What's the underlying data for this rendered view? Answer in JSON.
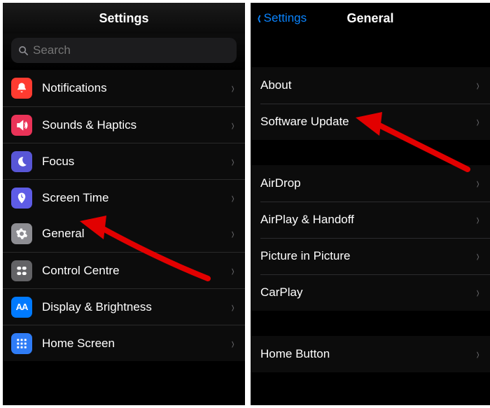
{
  "left": {
    "title": "Settings",
    "search_placeholder": "Search",
    "group1": [
      {
        "label": "Notifications"
      },
      {
        "label": "Sounds & Haptics"
      },
      {
        "label": "Focus"
      },
      {
        "label": "Screen Time"
      }
    ],
    "group2": [
      {
        "label": "General"
      },
      {
        "label": "Control Centre"
      },
      {
        "label": "Display & Brightness"
      },
      {
        "label": "Home Screen"
      }
    ]
  },
  "right": {
    "back_label": "Settings",
    "title": "General",
    "group1": [
      {
        "label": "About"
      },
      {
        "label": "Software Update"
      }
    ],
    "group2": [
      {
        "label": "AirDrop"
      },
      {
        "label": "AirPlay & Handoff"
      },
      {
        "label": "Picture in Picture"
      },
      {
        "label": "CarPlay"
      }
    ],
    "group3": [
      {
        "label": "Home Button"
      }
    ]
  }
}
